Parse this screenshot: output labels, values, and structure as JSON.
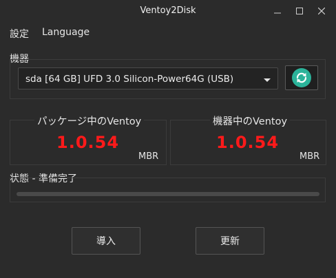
{
  "window": {
    "title": "Ventoy2Disk",
    "controls": [
      "minimize-icon",
      "maximize-icon",
      "close-icon"
    ]
  },
  "menu": {
    "items": [
      {
        "label": "設定"
      },
      {
        "label": "Language"
      }
    ]
  },
  "device": {
    "section_label": "機器",
    "selected": "sda  [64 GB]  UFD 3.0 Silicon-Power64G (USB)",
    "refresh_icon": "refresh-icon"
  },
  "versions": {
    "package": {
      "title": "パッケージ中のVentoy",
      "version": "1.0.54",
      "style": "MBR"
    },
    "device": {
      "title": "機器中のVentoy",
      "version": "1.0.54",
      "style": "MBR"
    }
  },
  "status": {
    "text": "状態 - 準備完了",
    "progress": 0
  },
  "buttons": {
    "install": "導入",
    "update": "更新"
  },
  "colors": {
    "background": "#2b2b2b",
    "version_red": "#ff1a1a",
    "accent_teal": "#2bb39a"
  }
}
